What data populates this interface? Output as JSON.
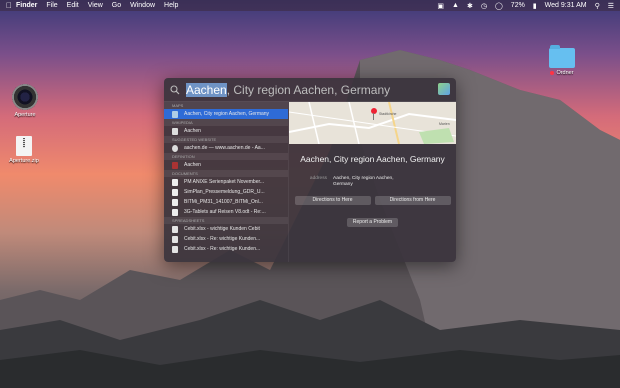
{
  "menubar": {
    "app": "Finder",
    "menus": [
      "File",
      "Edit",
      "View",
      "Go",
      "Window",
      "Help"
    ],
    "battery": "72%",
    "clock": "Wed 9:31 AM"
  },
  "desktop": {
    "camera_label": "Aperture",
    "zip_label": "Aperture.zip",
    "folder_label": "Ordner"
  },
  "spotlight": {
    "query_selected": "Aachen",
    "query_rest": ", City region Aachen, Germany",
    "results": [
      {
        "category": "Maps"
      },
      {
        "label": "Aachen, City region Aachen, Germany",
        "icon": "map-icon",
        "selected": true
      },
      {
        "category": "Wikipedia"
      },
      {
        "label": "Aachen",
        "icon": "wiki-icon"
      },
      {
        "category": "Suggested Website"
      },
      {
        "label": "aachen.de  — www.aachen.de - Aa...",
        "icon": "safari-icon"
      },
      {
        "category": "Definition"
      },
      {
        "label": "Aachen",
        "icon": "dictionary-icon"
      },
      {
        "category": "Documents"
      },
      {
        "label": "PM ANIXE Serienpaket November...",
        "icon": "document-icon"
      },
      {
        "label": "SimPlan_Pressemeldung_GDR_U...",
        "icon": "document-icon"
      },
      {
        "label": "BITMi_PM31_141007_BITMi_Onl...",
        "icon": "document-icon"
      },
      {
        "label": "3G-Tablets auf Reisen V8.odt  - Re:...",
        "icon": "document-icon"
      },
      {
        "category": "Spreadsheets"
      },
      {
        "label": "Cebit.xlsx  - wichtige Kunden Cebit",
        "icon": "spreadsheet-icon"
      },
      {
        "label": "Cebit.xlsx  - Re: wichtige Kunden...",
        "icon": "spreadsheet-icon"
      },
      {
        "label": "Cebit.xlsx  - Re: wichtige Kunden...",
        "icon": "spreadsheet-icon"
      }
    ],
    "detail": {
      "title": "Aachen, City region Aachen, Germany",
      "address_key": "address",
      "address_line1": "Aachen, City region Aachen,",
      "address_line2": "Germany",
      "directions_to": "Directions to Here",
      "directions_from": "Directions from Here",
      "report": "Report a Problem",
      "map_labels": [
        "Stadtkirche",
        "Marien"
      ]
    }
  }
}
